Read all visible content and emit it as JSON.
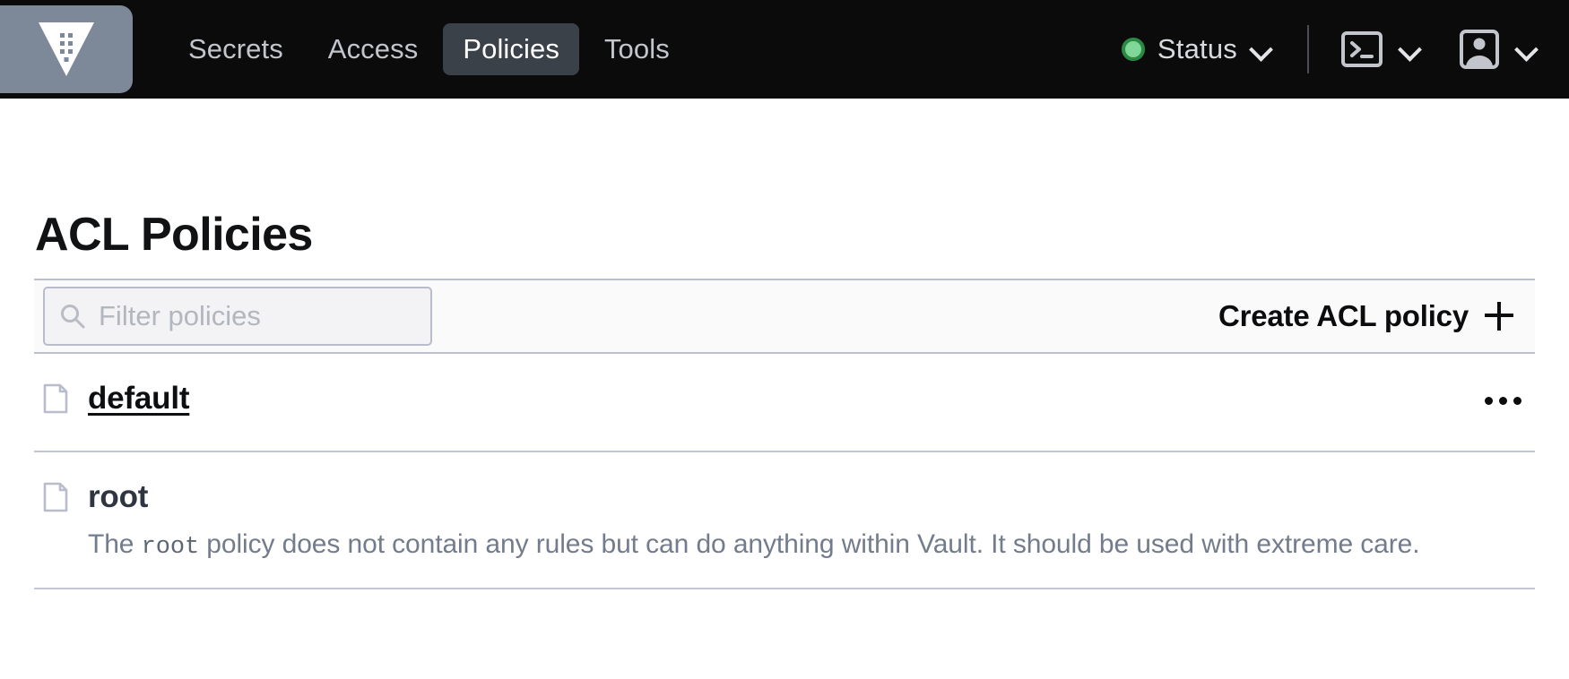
{
  "navbar": {
    "logo_name": "vault-logo",
    "tabs": [
      {
        "label": "Secrets",
        "active": false
      },
      {
        "label": "Access",
        "active": false
      },
      {
        "label": "Policies",
        "active": true
      },
      {
        "label": "Tools",
        "active": false
      }
    ],
    "status": {
      "label": "Status",
      "indicator_color": "#7fd79a",
      "indicator_ring_color": "#2a8a43"
    },
    "console_icon": "terminal-icon",
    "user_icon": "user-avatar-icon",
    "background_color": "#0b0b0c",
    "active_tab_color": "#3b4149"
  },
  "main": {
    "title": "ACL Policies",
    "toolbar": {
      "filter_placeholder": "Filter policies",
      "filter_value": "",
      "create_label": "Create ACL policy"
    },
    "policies": [
      {
        "name": "default",
        "is_link": true,
        "description": "",
        "has_menu": true
      },
      {
        "name": "root",
        "is_link": false,
        "description_prefix": "The ",
        "description_code": "root",
        "description_suffix": " policy does not contain any rules but can do anything within Vault. It should be used with extreme care.",
        "has_menu": false
      }
    ]
  }
}
